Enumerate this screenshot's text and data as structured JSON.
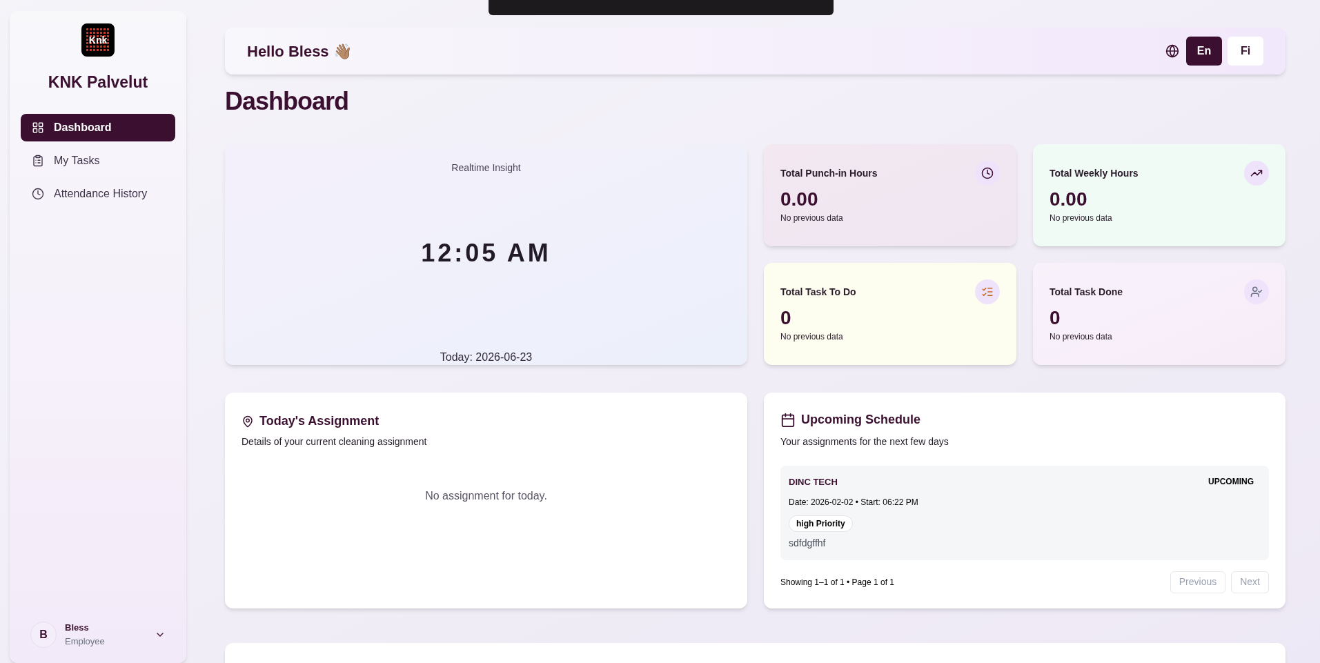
{
  "sidebar": {
    "brand_logo": "Knk",
    "brand": "KNK Palvelut",
    "items": [
      {
        "label": "Dashboard",
        "selected": true
      },
      {
        "label": "My Tasks",
        "selected": false
      },
      {
        "label": "Attendance History",
        "selected": false
      }
    ],
    "user": {
      "initial": "B",
      "name": "Bless",
      "role": "Employee"
    }
  },
  "header": {
    "greeting": "Hello Bless 👋🏽",
    "languages": [
      {
        "label": "En",
        "selected": true
      },
      {
        "label": "Fi",
        "selected": false
      }
    ]
  },
  "page_title": "Dashboard",
  "clock_card": {
    "label": "Realtime Insight",
    "time": "12:05 AM",
    "date": "Today: 2026-06-23"
  },
  "stats": [
    {
      "title": "Total Punch-in Hours",
      "value": "0.00",
      "note": "No previous data"
    },
    {
      "title": "Total Weekly Hours",
      "value": "0.00",
      "note": "No previous data"
    },
    {
      "title": "Total Task To Do",
      "value": "0",
      "note": "No previous data"
    },
    {
      "title": "Total Task Done",
      "value": "0",
      "note": "No previous data"
    }
  ],
  "assignment": {
    "title": "Today's Assignment",
    "subtitle": "Details of your current cleaning assignment",
    "empty": "No assignment for today."
  },
  "schedule": {
    "title": "Upcoming Schedule",
    "subtitle": "Your assignments for the next few days",
    "items": [
      {
        "client": "DINC TECH",
        "status": "UPCOMING",
        "details": "Date: 2026-02-02 • Start: 06:22 PM",
        "priority": "high Priority",
        "note": "sdfdgffhf"
      }
    ],
    "pagination": "Showing 1–1 of 1 • Page 1 of 1",
    "buttons": [
      {
        "label": "Previous",
        "disabled": true
      },
      {
        "label": "Next",
        "disabled": true
      }
    ]
  }
}
